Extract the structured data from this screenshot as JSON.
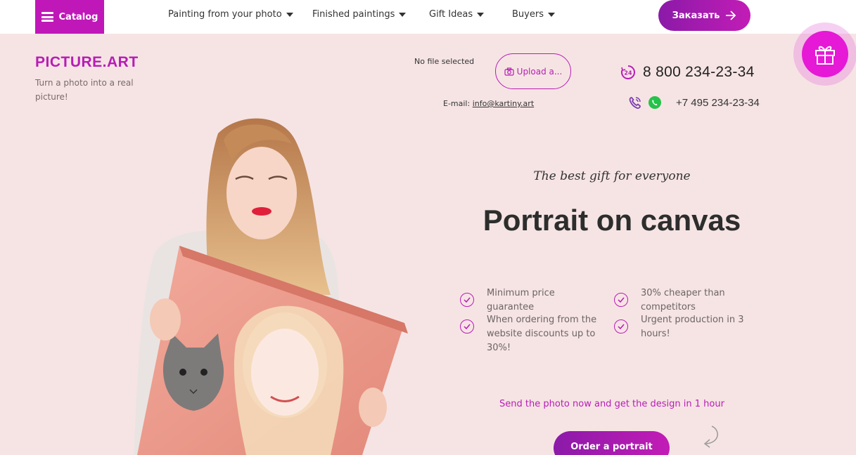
{
  "nav": {
    "catalog_label": "Catalog",
    "items": [
      {
        "label": "Painting from your photo"
      },
      {
        "label": "Finished paintings"
      },
      {
        "label": "Gift Ideas"
      },
      {
        "label": "Buyers"
      }
    ],
    "order_label": "Заказать"
  },
  "header": {
    "logo": "PICTURE.ART",
    "tagline": "Turn a photo into a real picture!",
    "file_status": "No file selected",
    "upload_label": "Upload a...",
    "email_label": "E-mail:",
    "email": "info@kartiny.art",
    "phone_main": "8 800 234-23-34",
    "phone_secondary": "+7 495 234-23-34"
  },
  "hero": {
    "kicker": "The best gift for everyone",
    "title": "Portrait on canvas",
    "features": [
      {
        "text": "Minimum price guarantee"
      },
      {
        "text": "30% cheaper than competitors"
      },
      {
        "text": "When ordering from the website discounts up to 30%!"
      },
      {
        "text": "Urgent production in 3 hours!"
      }
    ],
    "cta_note": "Send the photo now and get the design in 1 hour",
    "order_label": "Order a portrait"
  },
  "colors": {
    "brand": "#b81cb6",
    "background": "#f6e4e4",
    "gift_button": "#e619d6"
  },
  "icons": [
    "menu-icon",
    "chevron-down-icon",
    "arrow-right-icon",
    "gift-icon",
    "camera-icon",
    "phone-24-icon",
    "viber-icon",
    "whatsapp-icon",
    "check-circle-icon",
    "curved-arrow-icon"
  ]
}
